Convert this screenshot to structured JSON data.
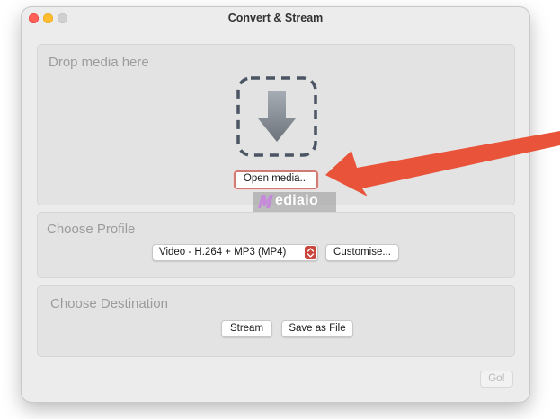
{
  "window": {
    "title": "Convert & Stream"
  },
  "drop": {
    "label": "Drop media here",
    "open_button": "Open media..."
  },
  "profile": {
    "label": "Choose Profile",
    "selected": "Video - H.264 + MP3 (MP4)",
    "customise": "Customise..."
  },
  "destination": {
    "label": "Choose Destination",
    "stream": "Stream",
    "save_file": "Save as File"
  },
  "footer": {
    "go": "Go!"
  },
  "watermark": {
    "text": "ediaio"
  },
  "colors": {
    "annotation_arrow": "#e8533a",
    "traffic_red": "#ff5f57",
    "traffic_yellow": "#febc2e",
    "accent": "#c9463d"
  },
  "icons": [
    "download-arrow-icon",
    "chevron-updown-icon",
    "mediaio-logo-icon",
    "annotation-arrow-icon"
  ]
}
